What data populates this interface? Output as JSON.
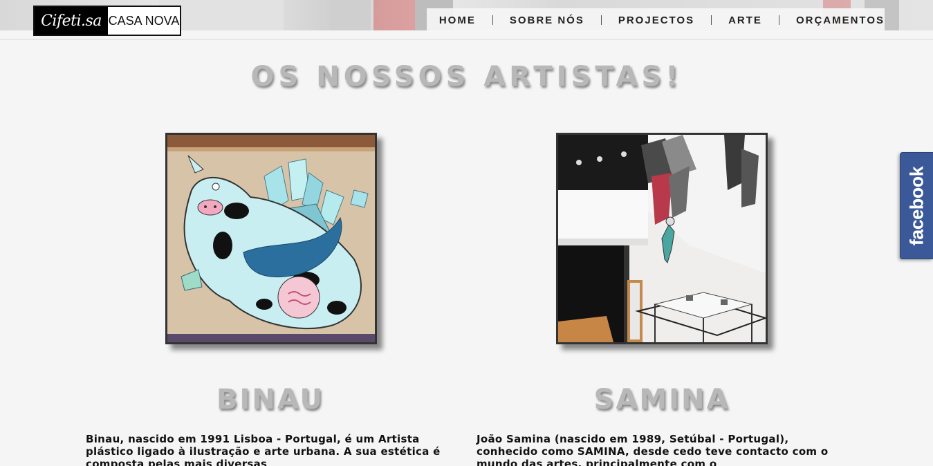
{
  "header": {
    "logo_script": "Cifeti.sa",
    "logo_text": "CASA NOVA"
  },
  "nav": {
    "items": [
      {
        "label": "HOME"
      },
      {
        "label": "SOBRE NÓS"
      },
      {
        "label": "PROJECTOS"
      },
      {
        "label": "ARTE"
      },
      {
        "label": "ORÇAMENTOS"
      }
    ]
  },
  "main": {
    "title": "OS NOSSOS ARTISTAS!",
    "artists": [
      {
        "name": "BINAU",
        "bio": "Binau, nascido em 1991 Lisboa - Portugal, é um Artista plástico ligado à ilustração e arte urbana. A sua estética é composta pelas mais diversas"
      },
      {
        "name": "SAMINA",
        "bio": "João Samina (nascido em 1989, Setúbal - Portugal), conhecido como SAMINA, desde cedo teve contacto com o mundo das artes, principalmente com o"
      }
    ]
  },
  "social": {
    "facebook_label": "facebook"
  },
  "colors": {
    "facebook_blue": "#3b5998",
    "title_gray": "#b8b8b8"
  }
}
